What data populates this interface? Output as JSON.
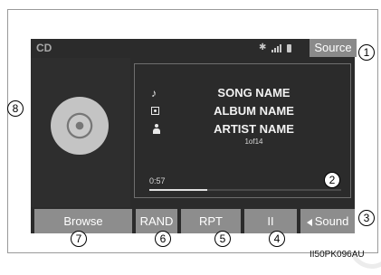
{
  "topbar": {
    "title": "CD",
    "source_label": "Source"
  },
  "status_icons": [
    "bluetooth-icon",
    "signal-icon",
    "battery-icon"
  ],
  "now_playing": {
    "song": "SONG NAME",
    "album": "ALBUM NAME",
    "artist": "ARTIST NAME",
    "track_position": "1of14",
    "elapsed": "0:57",
    "progress_fraction": 0.3
  },
  "controls": {
    "browse": "Browse",
    "rand": "RAND",
    "rpt": "RPT",
    "pause": "II",
    "sound": "Sound"
  },
  "callouts": [
    "1",
    "2",
    "3",
    "4",
    "5",
    "6",
    "7",
    "8"
  ],
  "figure_code": "II50PK096AU",
  "colors": {
    "screen_bg": "#2b2b2b",
    "button_bg": "#8d8d8d",
    "text": "#f2f2f2"
  }
}
